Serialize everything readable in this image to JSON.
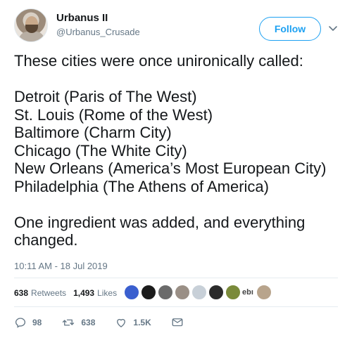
{
  "user": {
    "display_name": "Urbanus II",
    "handle": "@Urbanus_Crusade",
    "follow_label": "Follow"
  },
  "tweet": {
    "lines": [
      "These cities were once unironically called:",
      "",
      "Detroit (Paris of The West)",
      "St. Louis (Rome of the West)",
      "Baltimore (Charm City)",
      "Chicago (The White City)",
      "New Orleans (America’s Most European City)",
      "Philadelphia (The Athens of America)",
      "",
      "One ingredient was added, and everything",
      "changed."
    ],
    "timestamp": "10:11 AM - 18 Jul 2019"
  },
  "stats": {
    "retweets_count": "638",
    "retweets_label": "Retweets",
    "likes_count": "1,493",
    "likes_label": "Likes",
    "liker_text": "ebı"
  },
  "actions": {
    "reply_count": "98",
    "retweet_count": "638",
    "like_count": "1.5K"
  },
  "colors": {
    "accent": "#1da1f2",
    "secondary_text": "#657786",
    "divider": "#e6ecf0"
  }
}
